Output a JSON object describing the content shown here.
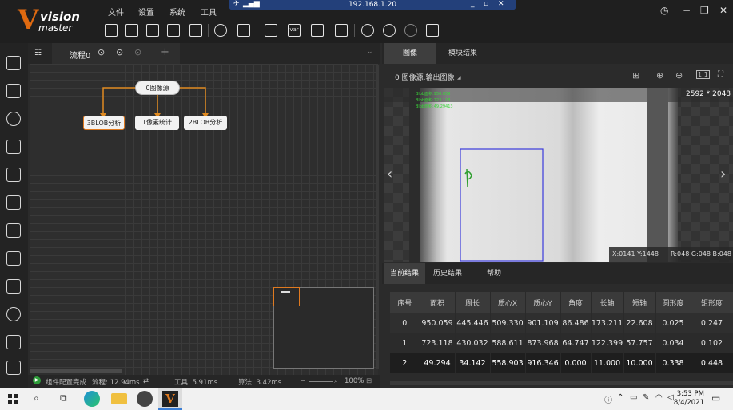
{
  "app": {
    "logo_main": "vision",
    "logo_sub": "master",
    "menus": [
      "文件",
      "设置",
      "系统",
      "工具"
    ],
    "remote_ip": "192.168.1.20"
  },
  "process": {
    "tab_label": "流程0",
    "nodes": {
      "source": "0图像源",
      "blob3": "3BLOB分析",
      "pixel": "1像素统计",
      "blob2": "2BLOB分析"
    }
  },
  "status": {
    "config_done": "组件配置完成",
    "flow_time": "流程: 12.94ms",
    "tool_time": "工具: 5.91ms",
    "algo_time": "算法: 3.42ms",
    "zoom": "100%"
  },
  "image_panel": {
    "tabs": [
      "图像",
      "模块结果"
    ],
    "active_tab": "图像",
    "source_label": "0 图像源.输出图像",
    "resolution": "2592 * 2048",
    "overlay_lines": [
      "Blob面积:950.059",
      "Blob面积:723.118",
      "Blob面积:49.29413"
    ],
    "coords": "X:0141  Y:1448",
    "rgb": "R:048  G:048  B:048"
  },
  "results": {
    "tabs": [
      "当前结果",
      "历史结果",
      "帮助"
    ],
    "active_tab": "当前结果",
    "columns": [
      "序号",
      "面积",
      "周长",
      "质心X",
      "质心Y",
      "角度",
      "长轴",
      "短轴",
      "圆形度",
      "矩形度"
    ],
    "rows": [
      [
        "0",
        "950.059",
        "445.446",
        "509.330",
        "901.109",
        "86.486",
        "173.211",
        "22.608",
        "0.025",
        "0.247"
      ],
      [
        "1",
        "723.118",
        "430.032",
        "588.611",
        "873.968",
        "64.747",
        "122.399",
        "57.757",
        "0.034",
        "0.102"
      ],
      [
        "2",
        "49.294",
        "34.142",
        "558.903",
        "916.346",
        "0.000",
        "11.000",
        "10.000",
        "0.338",
        "0.448"
      ]
    ]
  },
  "taskbar": {
    "time": "3:53 PM",
    "date": "8/4/2021"
  },
  "colors": {
    "accent": "#e07a20",
    "roi": "#3a3adc",
    "overlay_text": "#39d839"
  }
}
